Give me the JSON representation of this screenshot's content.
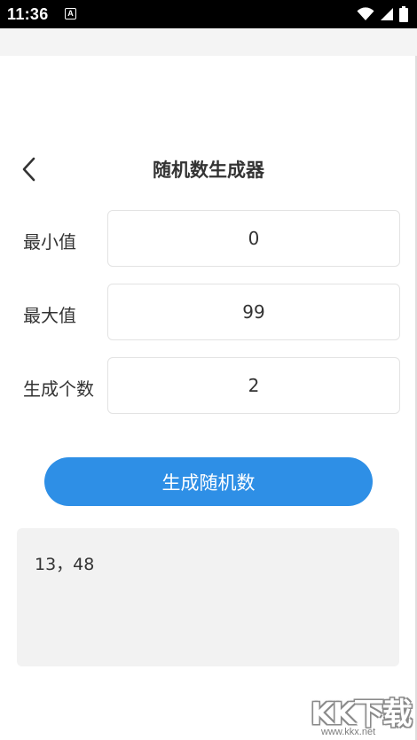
{
  "status_bar": {
    "time": "11:36",
    "notification_glyph": "A",
    "icons": [
      "wifi-icon",
      "signal-icon",
      "battery-icon"
    ]
  },
  "header": {
    "back_icon": "chevron-left-icon",
    "title": "随机数生成器"
  },
  "form": {
    "min": {
      "label": "最小值",
      "value": "0"
    },
    "max": {
      "label": "最大值",
      "value": "99"
    },
    "count": {
      "label": "生成个数",
      "value": "2"
    }
  },
  "actions": {
    "generate_label": "生成随机数"
  },
  "result": {
    "text": "13，48"
  },
  "watermark": {
    "logo": "KK下载",
    "url": "www.kkx.net"
  },
  "colors": {
    "accent": "#2e8fe6",
    "text": "#333333",
    "result_background": "#f2f2f2",
    "status_bar": "#000000"
  }
}
